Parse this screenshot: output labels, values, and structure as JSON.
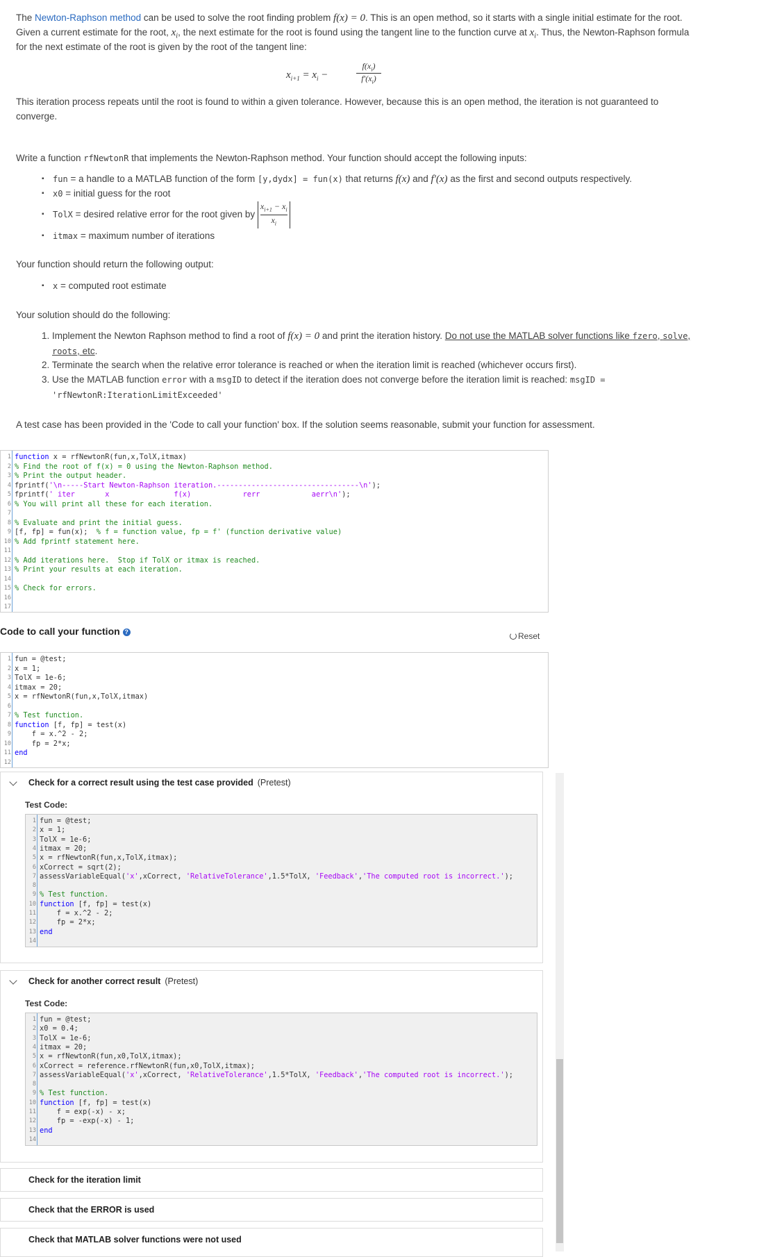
{
  "intro": {
    "p1_pre": "The ",
    "p1_link": "Newton-Raphson method",
    "p1_mid": " can be used to solve the root finding problem ",
    "p1_math": "f(x) = 0",
    "p1_post": ". This is an open method, so it starts with a single initial estimate for the root.",
    "p2_pre": "Given a current estimate for the root, ",
    "p2_math": "x",
    "p2_sub": "i",
    "p2_mid": ", the next estimate for the root is found using the tangent line to the function curve at ",
    "p2_math2": "x",
    "p2_sub2": "i",
    "p2_post": ". Thus, the Newton-Raphson formula",
    "p3": "for the next estimate of the root is given by the root of the tangent line:",
    "formula_lhs": "x",
    "formula_lhs_sub": "i+1",
    "formula_eq": " = x",
    "formula_eq_sub": "i",
    "formula_minus": " − ",
    "formula_num": "f(x",
    "formula_num_sub": "i",
    "formula_num_close": ")",
    "formula_den": "f′(x",
    "formula_den_sub": "i",
    "formula_den_close": ")",
    "p4": "This iteration process repeats until the root is found to within a given tolerance. However, because this is an open method, the iteration is not guaranteed to",
    "p5": "converge."
  },
  "task": {
    "write_pre": "Write a function ",
    "write_code": "rfNewtonR",
    "write_post": " that implements the Newton-Raphson method. Your function should accept the following inputs:",
    "inputs": [
      {
        "code": "fun",
        "text1": " = a handle to a MATLAB function of the form ",
        "code2": "[y,dydx] = fun(x)",
        "text2": " that returns ",
        "math1": "f(x)",
        "text3": " and ",
        "math2": "f′(x)",
        "text4": " as the first and second outputs respectively."
      },
      {
        "code": "x0",
        "text1": " = initial guess for the root"
      },
      {
        "code": "TolX",
        "text1": " = desired relative error for the root given by "
      },
      {
        "code": "itmax",
        "text1": " = maximum number of iterations"
      }
    ],
    "tol_num": "x",
    "tol_num_sub": "i+1",
    "tol_num_mid": " − x",
    "tol_num_sub2": "i",
    "tol_den": "x",
    "tol_den_sub": "i",
    "return_text": "Your function should return the following output:",
    "output": {
      "code": "x",
      "text": " = computed root estimate"
    },
    "do_text": "Your solution should do the following:",
    "steps": [
      {
        "num": "1.",
        "pre": "Implement the Newton Raphson method to find a root of ",
        "math": "f(x) = 0",
        "mid": " and print the iteration history. ",
        "under1": "Do not use the MATLAB solver functions like ",
        "ucode1": "fzero",
        "usep1": ", ",
        "ucode2": "solve",
        "usep2": ", ",
        "under2": "roots",
        "under3": ", etc",
        "post": "."
      },
      {
        "num": "2.",
        "text": "Terminate the search when the relative error tolerance is reached or when the iteration limit is reached (whichever occurs first)."
      },
      {
        "num": "3.",
        "pre": "Use the MATLAB function ",
        "code1": "error",
        "mid": " with a ",
        "code2": "msgID",
        "mid2": " to detect if the iteration does not converge before the iteration limit is reached: ",
        "code3": "msgID =",
        "code4": "'rfNewtonR:IterationLimitExceeded'"
      }
    ],
    "test_note": "A test case has been provided in the 'Code to call your function' box. If the solution seems reasonable, submit your function for assessment."
  },
  "function_editor": {
    "lines": [
      {
        "n": "1",
        "segs": [
          {
            "t": "function",
            "c": "kw"
          },
          {
            "t": " x = rfNewtonR(fun,x,TolX,itmax)",
            "c": ""
          }
        ]
      },
      {
        "n": "2",
        "segs": [
          {
            "t": "% Find the root of f(x) = 0 using the Newton-Raphson method.",
            "c": "cm"
          }
        ]
      },
      {
        "n": "3",
        "segs": [
          {
            "t": "% Print the output header.",
            "c": "cm"
          }
        ]
      },
      {
        "n": "4",
        "segs": [
          {
            "t": "fprintf(",
            "c": ""
          },
          {
            "t": "'\\n-----Start Newton-Raphson iteration.---------------------------------\\n'",
            "c": "st"
          },
          {
            "t": ");",
            "c": ""
          }
        ]
      },
      {
        "n": "5",
        "segs": [
          {
            "t": "fprintf(",
            "c": ""
          },
          {
            "t": "' iter       x               f(x)            rerr            aerr\\n'",
            "c": "st"
          },
          {
            "t": ");",
            "c": ""
          }
        ]
      },
      {
        "n": "6",
        "segs": [
          {
            "t": "% You will print all these for each iteration.",
            "c": "cm"
          }
        ]
      },
      {
        "n": "7",
        "segs": []
      },
      {
        "n": "8",
        "segs": [
          {
            "t": "% Evaluate and print the initial guess.",
            "c": "cm"
          }
        ]
      },
      {
        "n": "9",
        "segs": [
          {
            "t": "[f, fp] = fun(x);  ",
            "c": ""
          },
          {
            "t": "% f = function value, fp = f' (function derivative value)",
            "c": "cm"
          }
        ]
      },
      {
        "n": "10",
        "segs": [
          {
            "t": "% Add fprintf statement here.",
            "c": "cm"
          }
        ]
      },
      {
        "n": "11",
        "segs": []
      },
      {
        "n": "12",
        "segs": [
          {
            "t": "% Add iterations here.  Stop if TolX or itmax is reached.",
            "c": "cm"
          }
        ]
      },
      {
        "n": "13",
        "segs": [
          {
            "t": "% Print your results at each iteration.",
            "c": "cm"
          }
        ]
      },
      {
        "n": "14",
        "segs": []
      },
      {
        "n": "15",
        "segs": [
          {
            "t": "% Check for errors.",
            "c": "cm"
          }
        ]
      },
      {
        "n": "16",
        "segs": []
      },
      {
        "n": "17",
        "segs": []
      }
    ]
  },
  "call_section": {
    "title": "Code to call your function",
    "help": "?",
    "reset_icon": "reset-icon",
    "reset": "Reset",
    "lines": [
      {
        "n": "1",
        "segs": [
          {
            "t": "fun = @test;",
            "c": ""
          }
        ]
      },
      {
        "n": "2",
        "segs": [
          {
            "t": "x = 1;",
            "c": ""
          }
        ]
      },
      {
        "n": "3",
        "segs": [
          {
            "t": "TolX = 1e-6;",
            "c": ""
          }
        ]
      },
      {
        "n": "4",
        "segs": [
          {
            "t": "itmax = 20;",
            "c": ""
          }
        ]
      },
      {
        "n": "5",
        "segs": [
          {
            "t": "x = rfNewtonR(fun,x,TolX,itmax)",
            "c": ""
          }
        ]
      },
      {
        "n": "6",
        "segs": []
      },
      {
        "n": "7",
        "segs": [
          {
            "t": "% Test function.",
            "c": "cm"
          }
        ]
      },
      {
        "n": "8",
        "segs": [
          {
            "t": "function",
            "c": "kw"
          },
          {
            "t": " [f, fp] = test(x)",
            "c": ""
          }
        ]
      },
      {
        "n": "9",
        "segs": [
          {
            "t": "    f = x.^2 - 2;",
            "c": ""
          }
        ]
      },
      {
        "n": "10",
        "segs": [
          {
            "t": "    fp = 2*x;",
            "c": ""
          }
        ]
      },
      {
        "n": "11",
        "segs": [
          {
            "t": "end",
            "c": "kw"
          }
        ]
      },
      {
        "n": "12",
        "segs": []
      }
    ]
  },
  "tests": [
    {
      "title": "Check for a correct result using the test case provided",
      "tag": "(Pretest)",
      "label": "Test Code:",
      "lines": [
        {
          "n": "1",
          "segs": [
            {
              "t": "fun = @test;",
              "c": ""
            }
          ]
        },
        {
          "n": "2",
          "segs": [
            {
              "t": "x = 1;",
              "c": ""
            }
          ]
        },
        {
          "n": "3",
          "segs": [
            {
              "t": "TolX = 1e-6;",
              "c": ""
            }
          ]
        },
        {
          "n": "4",
          "segs": [
            {
              "t": "itmax = 20;",
              "c": ""
            }
          ]
        },
        {
          "n": "5",
          "segs": [
            {
              "t": "x = rfNewtonR(fun,x,TolX,itmax);",
              "c": ""
            }
          ]
        },
        {
          "n": "6",
          "segs": [
            {
              "t": "xCorrect = sqrt(2);",
              "c": ""
            }
          ]
        },
        {
          "n": "7",
          "segs": [
            {
              "t": "assessVariableEqual(",
              "c": ""
            },
            {
              "t": "'x'",
              "c": "st"
            },
            {
              "t": ",xCorrect, ",
              "c": ""
            },
            {
              "t": "'RelativeTolerance'",
              "c": "st"
            },
            {
              "t": ",1.5*TolX, ",
              "c": ""
            },
            {
              "t": "'Feedback'",
              "c": "st"
            },
            {
              "t": ",",
              "c": ""
            },
            {
              "t": "'The computed root is incorrect.'",
              "c": "st"
            },
            {
              "t": ");",
              "c": ""
            }
          ]
        },
        {
          "n": "8",
          "segs": []
        },
        {
          "n": "9",
          "segs": [
            {
              "t": "% Test function.",
              "c": "cm"
            }
          ]
        },
        {
          "n": "10",
          "segs": [
            {
              "t": "function",
              "c": "kw"
            },
            {
              "t": " [f, fp] = test(x)",
              "c": ""
            }
          ]
        },
        {
          "n": "11",
          "segs": [
            {
              "t": "    f = x.^2 - 2;",
              "c": ""
            }
          ]
        },
        {
          "n": "12",
          "segs": [
            {
              "t": "    fp = 2*x;",
              "c": ""
            }
          ]
        },
        {
          "n": "13",
          "segs": [
            {
              "t": "end",
              "c": "kw"
            }
          ]
        },
        {
          "n": "14",
          "segs": []
        }
      ]
    },
    {
      "title": "Check for another correct result",
      "tag": "(Pretest)",
      "label": "Test Code:",
      "lines": [
        {
          "n": "1",
          "segs": [
            {
              "t": "fun = @test;",
              "c": ""
            }
          ]
        },
        {
          "n": "2",
          "segs": [
            {
              "t": "x0 = 0.4;",
              "c": ""
            }
          ]
        },
        {
          "n": "3",
          "segs": [
            {
              "t": "TolX = 1e-6;",
              "c": ""
            }
          ]
        },
        {
          "n": "4",
          "segs": [
            {
              "t": "itmax = 20;",
              "c": ""
            }
          ]
        },
        {
          "n": "5",
          "segs": [
            {
              "t": "x = rfNewtonR(fun,x0,TolX,itmax);",
              "c": ""
            }
          ]
        },
        {
          "n": "6",
          "segs": [
            {
              "t": "xCorrect = reference.rfNewtonR(fun,x0,TolX,itmax);",
              "c": ""
            }
          ]
        },
        {
          "n": "7",
          "segs": [
            {
              "t": "assessVariableEqual(",
              "c": ""
            },
            {
              "t": "'x'",
              "c": "st"
            },
            {
              "t": ",xCorrect, ",
              "c": ""
            },
            {
              "t": "'RelativeTolerance'",
              "c": "st"
            },
            {
              "t": ",1.5*TolX, ",
              "c": ""
            },
            {
              "t": "'Feedback'",
              "c": "st"
            },
            {
              "t": ",",
              "c": ""
            },
            {
              "t": "'The computed root is incorrect.'",
              "c": "st"
            },
            {
              "t": ");",
              "c": ""
            }
          ]
        },
        {
          "n": "8",
          "segs": []
        },
        {
          "n": "9",
          "segs": [
            {
              "t": "% Test function.",
              "c": "cm"
            }
          ]
        },
        {
          "n": "10",
          "segs": [
            {
              "t": "function",
              "c": "kw"
            },
            {
              "t": " [f, fp] = test(x)",
              "c": ""
            }
          ]
        },
        {
          "n": "11",
          "segs": [
            {
              "t": "    f = exp(-x) - x;",
              "c": ""
            }
          ]
        },
        {
          "n": "12",
          "segs": [
            {
              "t": "    fp = -exp(-x) - 1;",
              "c": ""
            }
          ]
        },
        {
          "n": "13",
          "segs": [
            {
              "t": "end",
              "c": "kw"
            }
          ]
        },
        {
          "n": "14",
          "segs": []
        }
      ]
    }
  ],
  "collapsed_tests": [
    {
      "title": "Check for the iteration limit"
    },
    {
      "title": "Check that the ERROR is used"
    },
    {
      "title": "Check that MATLAB solver functions were not used"
    }
  ],
  "colors": {
    "link": "#2a6ac0",
    "keyword": "#0e00ff",
    "comment": "#228b22",
    "string": "#a709f5"
  }
}
